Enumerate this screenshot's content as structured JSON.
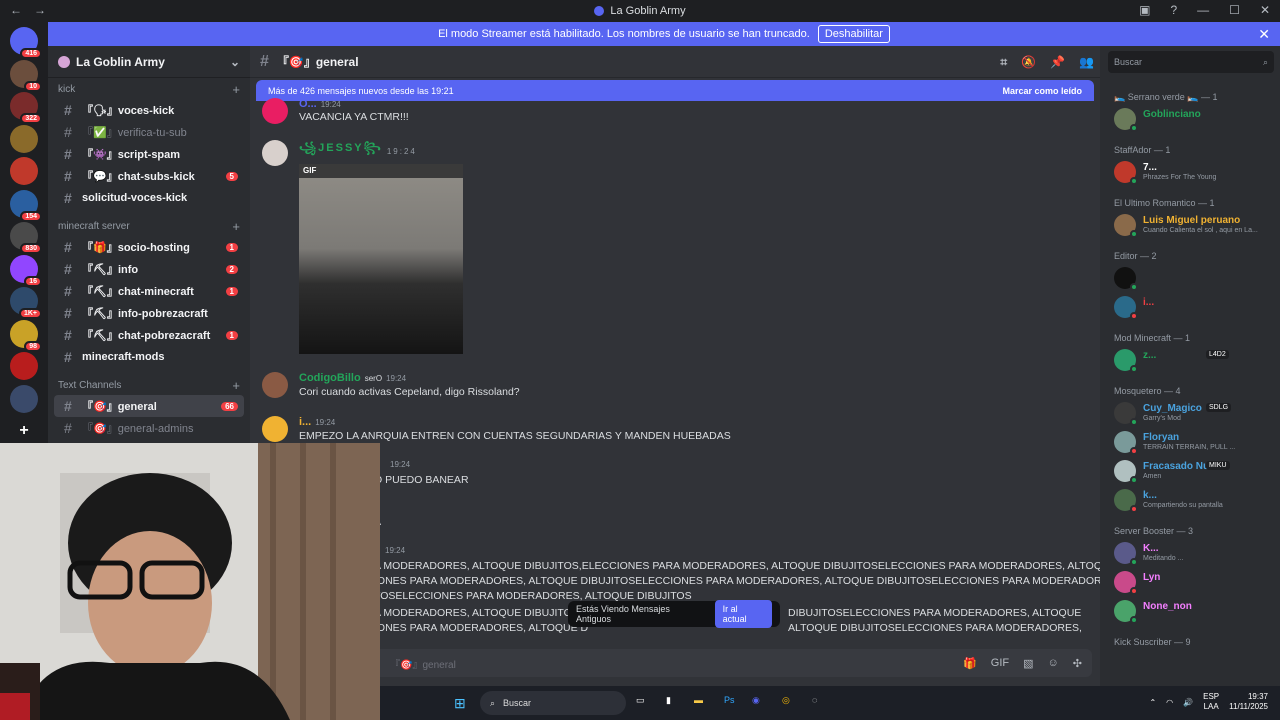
{
  "window": {
    "title": "La Goblin Army"
  },
  "streamer_banner": {
    "text": "El modo Streamer está habilitado. Los nombres de usuario se han truncado.",
    "button": "Deshabilitar"
  },
  "servers": [
    {
      "badge": "416",
      "color": "#5865f2"
    },
    {
      "badge": "10",
      "color": "#6b4e3d"
    },
    {
      "badge": "322",
      "color": "#7a2b2b"
    },
    {
      "badge": "",
      "color": "#8a6a2a"
    },
    {
      "badge": "",
      "color": "#c0392b"
    },
    {
      "badge": "154",
      "color": "#2a5fa0"
    },
    {
      "badge": "830",
      "color": "#4a4a4a"
    },
    {
      "badge": "16",
      "color": "#9146ff"
    },
    {
      "badge": "1K+",
      "color": "#2e4a6b"
    },
    {
      "badge": "98",
      "color": "#c9a227"
    },
    {
      "badge": "",
      "color": "#b81d1d"
    },
    {
      "badge": "",
      "color": "#3a4a6a"
    }
  ],
  "sidebar": {
    "server_name": "La Goblin Army",
    "categories": [
      {
        "name": "kick",
        "channels": [
          {
            "name": "『🗣』voces-kick",
            "muted": false,
            "badge": ""
          },
          {
            "name": "『✅』verifica-tu-sub",
            "muted": true,
            "badge": ""
          },
          {
            "name": "『👾』script-spam",
            "muted": false,
            "badge": ""
          },
          {
            "name": "『💬』chat-subs-kick",
            "muted": false,
            "badge": "5"
          },
          {
            "name": "solicitud-voces-kick",
            "muted": false,
            "badge": ""
          }
        ]
      },
      {
        "name": "minecraft server",
        "channels": [
          {
            "name": "『🎁』socio-hosting",
            "muted": false,
            "badge": "1"
          },
          {
            "name": "『⛏』info",
            "muted": false,
            "badge": "2"
          },
          {
            "name": "『⛏』chat-minecraft",
            "muted": false,
            "badge": "1"
          },
          {
            "name": "『⛏』info-pobrezacraft",
            "muted": false,
            "badge": ""
          },
          {
            "name": "『⛏』chat-pobrezacraft",
            "muted": false,
            "badge": "1"
          },
          {
            "name": "minecraft-mods",
            "muted": false,
            "badge": ""
          }
        ]
      },
      {
        "name": "Text Channels",
        "channels": [
          {
            "name": "『🎯』general",
            "muted": false,
            "badge": "66",
            "active": true
          },
          {
            "name": "『🎯』general-admins",
            "muted": true,
            "badge": ""
          }
        ]
      }
    ]
  },
  "channel_header": {
    "name": "『🎯』general"
  },
  "new_messages": {
    "text": "Más de 426 mensajes nuevos desde las 19:21",
    "action": "Marcar como leído"
  },
  "messages": [
    {
      "user": "O...",
      "color": "#5865f2",
      "time": "19:24",
      "text": "VACANCIA YA CTMR!!!"
    },
    {
      "user": "꧁JESSY꧂",
      "color": "#23a55a",
      "time": "19:24",
      "text": ""
    },
    {
      "user": "CodigoBillo",
      "color": "#23a55a",
      "time": "19:24",
      "tag": "serO",
      "text": "Cori cuando activas Cepeland, digo Rissoland?"
    },
    {
      "user": "i...",
      "color": "#f0b232",
      "time": "19:24",
      "text": "EMPEZO LA ANRQUIA ENTREN CON CUENTAS SEGUNDARIAS Y MANDEN HUEBADAS"
    },
    {
      "user": "",
      "color": "#949ba4",
      "time": "19:24",
      "text": "O PUEDO BANEAR"
    },
    {
      "user": "",
      "color": "#949ba4",
      "time": "",
      "text": "A"
    },
    {
      "user": "",
      "color": "#949ba4",
      "time": "19:24",
      "text": ""
    }
  ],
  "long_text": [
    "A MODERADORES, ALTOQUE DIBUJITOS,ELECCIONES PARA MODERADORES, ALTOQUE DIBUJITOSELECCIONES PARA MODERADORES, ALTOQUE",
    "IONES PARA MODERADORES, ALTOQUE DIBUJITOSELECCIONES PARA MODERADORES, ALTOQUE DIBUJITOSELECCIONES PARA MODERADORES,",
    "TOSELECCIONES PARA MODERADORES, ALTOQUE DIBUJITOS",
    "A MODERADORES, ALTOQUE DIBUJITOS,",
    "DIBUJITOSELECCIONES PARA MODERADORES, ALTOQUE",
    "IONES PARA MODERADORES, ALTOQUE D",
    "ALTOQUE DIBUJITOSELECCIONES PARA MODERADORES,"
  ],
  "gif_label": "GIF",
  "old_banner": {
    "text": "Estás Viendo Mensajes Antiguos",
    "button": "Ir al actual"
  },
  "composer": {
    "placeholder": "『🎯』general"
  },
  "members_search": "Buscar",
  "member_groups": [
    {
      "role": "🛌 Serrano verde 🛌 — 1",
      "members": [
        {
          "name": "Goblinciano",
          "color": "#23a55a",
          "status": ""
        }
      ]
    },
    {
      "role": "StaffAdor — 1",
      "members": [
        {
          "name": "7...",
          "color": "#ffffff",
          "status": "Phrazes For The Young"
        }
      ]
    },
    {
      "role": "El Ultimo Romantico — 1",
      "members": [
        {
          "name": "Luis Miguel peruano",
          "color": "#f0b232",
          "status": "Cuando Calienta el sol , aqui en La..."
        }
      ]
    },
    {
      "role": "Editor — 2",
      "members": [
        {
          "name": "",
          "color": "#ffffff",
          "status": ""
        },
        {
          "name": "i...",
          "color": "#f23f43",
          "status": ""
        }
      ]
    },
    {
      "role": "Mod Minecraft — 1",
      "members": [
        {
          "name": "z...",
          "color": "#23a55a",
          "status": "",
          "tag": "L4D2"
        }
      ]
    },
    {
      "role": "Mosquetero — 4",
      "members": [
        {
          "name": "Cuy_Magico",
          "color": "#4aa3df",
          "status": "Garry's Mod",
          "tag": "SDLG"
        },
        {
          "name": "Floryan",
          "color": "#4aa3df",
          "status": "TERRAIN TERRAIN, PULL ..."
        },
        {
          "name": "Fracasado Nu...",
          "color": "#4aa3df",
          "status": "Amen",
          "tag": "MIKU"
        },
        {
          "name": "k...",
          "color": "#4aa3df",
          "status": "Compartiendo su pantalla"
        }
      ]
    },
    {
      "role": "Server Booster — 3",
      "members": [
        {
          "name": "K...",
          "color": "#f47fff",
          "status": "Meditando ..."
        },
        {
          "name": "Lyn",
          "color": "#f47fff",
          "status": ""
        },
        {
          "name": "None_non",
          "color": "#f47fff",
          "status": ""
        }
      ]
    },
    {
      "role": "Kick Suscriber — 9",
      "members": []
    }
  ],
  "taskbar": {
    "search": "Buscar",
    "lang": "ESP",
    "layout": "LAA",
    "time": "19:37",
    "date": "11/11/2025"
  }
}
